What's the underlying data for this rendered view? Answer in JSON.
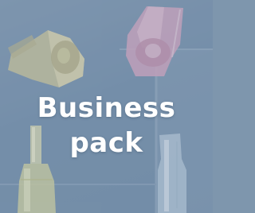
{
  "tile": {
    "title_line1": "Business",
    "title_line2": "pack"
  },
  "colors": {
    "background": "#7590aa",
    "gold_cap": "#d8cf9a",
    "pink_bottle": "#d5a6be",
    "text": "#ffffff"
  }
}
